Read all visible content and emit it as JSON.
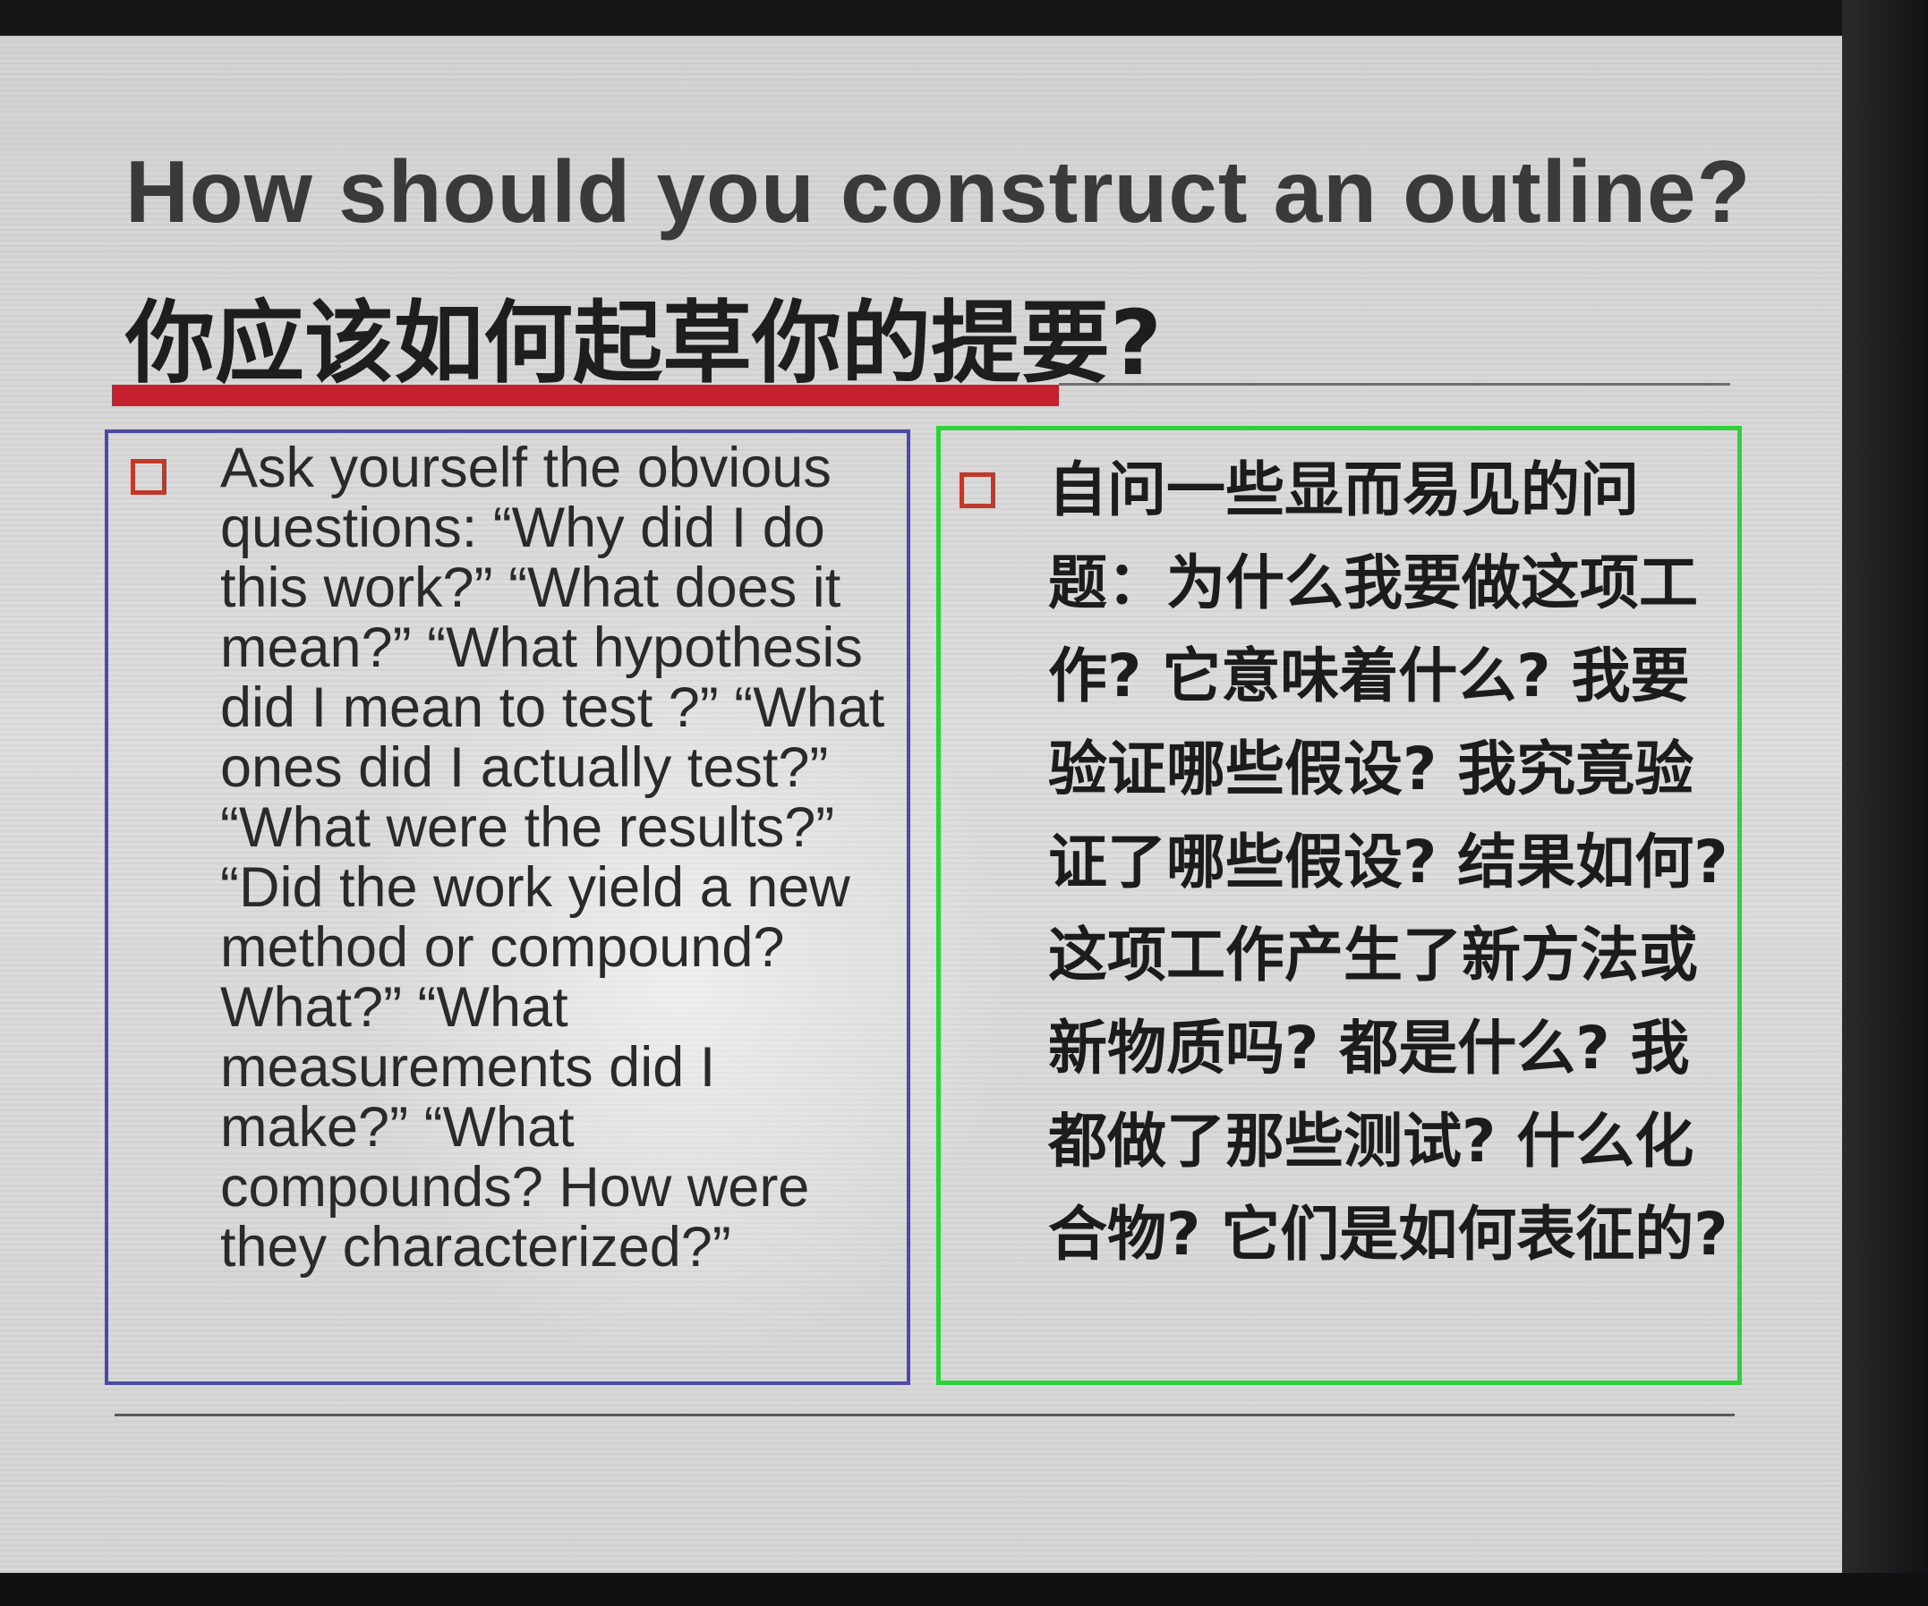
{
  "slide": {
    "title_en": "How should you construct an outline?",
    "title_zh": "你应该如何起草你的提要?",
    "left_box": {
      "text": "Ask yourself the obvious questions: “Why did I do this work?” “What does it mean?” “What hypothesis did I mean to test ?” “What ones did I actually test?” “What were the results?” “Did the work yield a new method or compound? What?” “What measurements did I make?” “What compounds? How were they characterized?”"
    },
    "right_box": {
      "text": "自问一些显而易见的问题：为什么我要做这项工作? 它意味着什么? 我要验证哪些假设? 我究竟验证了哪些假设?   结果如何?   这项工作产生了新方法或新物质吗? 都是什么? 我都做了那些测试? 什么化合物?   它们是如何表征的?"
    }
  },
  "colors": {
    "accent_red": "#c4202e",
    "left_border": "#4d4aa5",
    "right_border": "#2fd13a",
    "slide_bg": "#d8d8d8"
  }
}
